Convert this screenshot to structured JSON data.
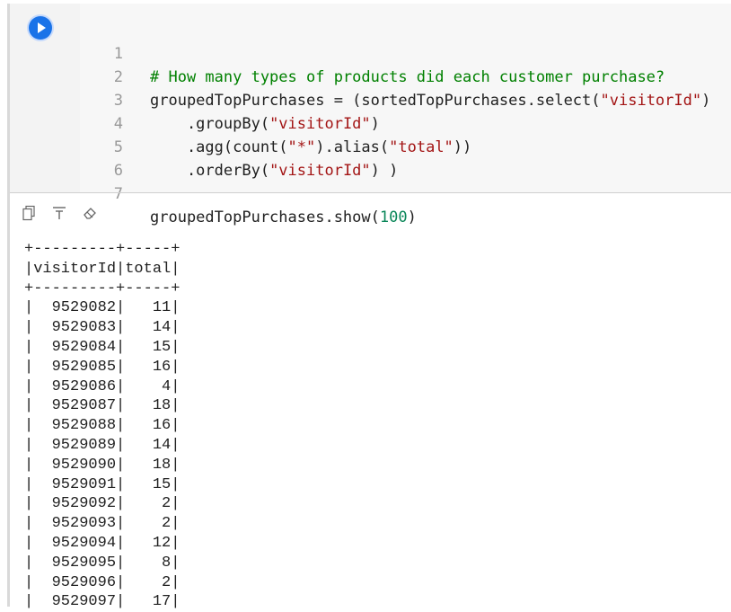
{
  "cell": {
    "run_icon": "play-icon",
    "line_numbers": [
      "1",
      "2",
      "3",
      "4",
      "5",
      "6",
      "7"
    ],
    "code": {
      "l1_comment": "# How many types of products did each customer purchase?",
      "l2_a": "groupedTopPurchases = (sortedTopPurchases.select(",
      "l2_str": "\"visitorId\"",
      "l2_b": ")",
      "l3_a": "    .groupBy(",
      "l3_str": "\"visitorId\"",
      "l3_b": ")",
      "l4_a": "    .agg(count(",
      "l4_str1": "\"*\"",
      "l4_b": ").alias(",
      "l4_str2": "\"total\"",
      "l4_c": "))",
      "l5_a": "    .orderBy(",
      "l5_str": "\"visitorId\"",
      "l5_b": ") )",
      "l7_a": "groupedTopPurchases.show(",
      "l7_num": "100",
      "l7_b": ")"
    }
  },
  "toolbar": {
    "icons": [
      "copy-icon",
      "clear-formatting-icon",
      "eraser-icon"
    ]
  },
  "output": {
    "border_top": "+---------+-----+",
    "header": "|visitorId|total|",
    "border_mid": "+---------+-----+",
    "rows": [
      "|  9529082|   11|",
      "|  9529083|   14|",
      "|  9529084|   15|",
      "|  9529085|   16|",
      "|  9529086|    4|",
      "|  9529087|   18|",
      "|  9529088|   16|",
      "|  9529089|   14|",
      "|  9529090|   18|",
      "|  9529091|   15|",
      "|  9529092|    2|",
      "|  9529093|    2|",
      "|  9529094|   12|",
      "|  9529095|    8|",
      "|  9529096|    2|",
      "|  9529097|   17|"
    ]
  }
}
